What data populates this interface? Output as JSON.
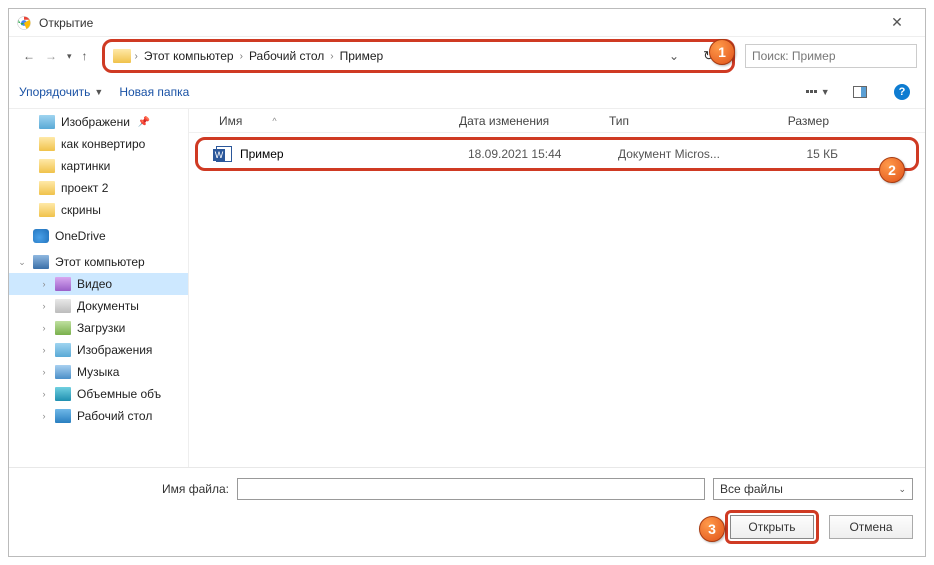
{
  "titlebar": {
    "title": "Открытие",
    "close": "✕"
  },
  "nav": {
    "crumbs": [
      "Этот компьютер",
      "Рабочий стол",
      "Пример"
    ],
    "search_placeholder": "Поиск: Пример"
  },
  "toolbar": {
    "organize": "Упорядочить",
    "new_folder": "Новая папка"
  },
  "sidebar": {
    "items": [
      {
        "label": "Изображени",
        "icon": "ic-img",
        "pinned": true
      },
      {
        "label": "как конвертиро",
        "icon": "ic-folder"
      },
      {
        "label": "картинки",
        "icon": "ic-folder"
      },
      {
        "label": "проект 2",
        "icon": "ic-folder"
      },
      {
        "label": "скрины",
        "icon": "ic-folder"
      }
    ],
    "onedrive": "OneDrive",
    "thispc": "Этот компьютер",
    "pc_items": [
      {
        "label": "Видео",
        "icon": "ic-video",
        "sel": true
      },
      {
        "label": "Документы",
        "icon": "ic-doc"
      },
      {
        "label": "Загрузки",
        "icon": "ic-dl"
      },
      {
        "label": "Изображения",
        "icon": "ic-img"
      },
      {
        "label": "Музыка",
        "icon": "ic-music"
      },
      {
        "label": "Объемные объ",
        "icon": "ic-3d"
      },
      {
        "label": "Рабочий стол",
        "icon": "ic-desk"
      }
    ]
  },
  "columns": {
    "name": "Имя",
    "date": "Дата изменения",
    "type": "Тип",
    "size": "Размер"
  },
  "files": [
    {
      "name": "Пример",
      "date": "18.09.2021 15:44",
      "type": "Документ Micros...",
      "size": "15 КБ"
    }
  ],
  "footer": {
    "filename_label": "Имя файла:",
    "filename_value": "",
    "filter": "Все файлы",
    "open": "Открыть",
    "cancel": "Отмена"
  },
  "callouts": {
    "c1": "1",
    "c2": "2",
    "c3": "3"
  }
}
